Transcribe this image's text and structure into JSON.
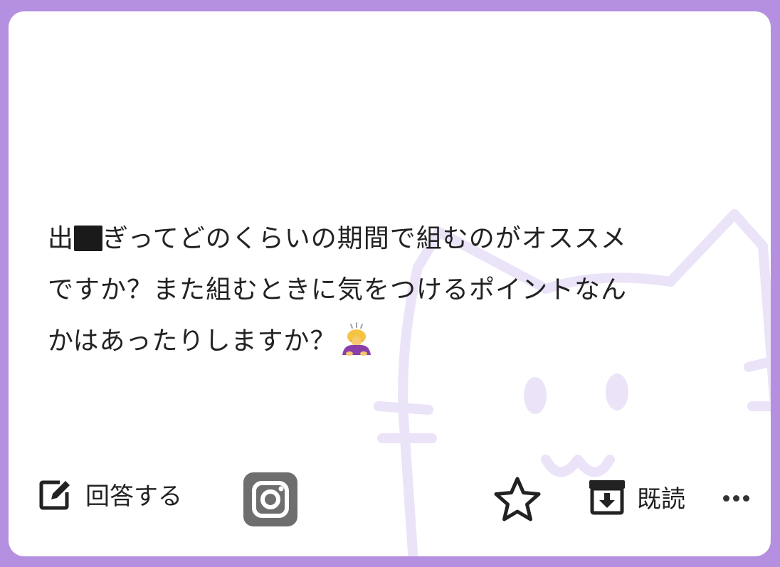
{
  "question": {
    "line1_prefix": "出",
    "line1_rest": "ぎってどのくらいの期間で組むのがオススメ",
    "line2": "ですか？また組むときに気をつけるポイントなん",
    "line3": "かはあったりしますか？"
  },
  "actions": {
    "answer_label": "回答する",
    "read_label": "既読"
  },
  "icons": [
    "edit-icon",
    "instagram-icon",
    "star-icon",
    "archive-icon",
    "more-icon",
    "bowing-person-emoji",
    "cat-watermark"
  ],
  "colors": {
    "frame": "#b58fe0",
    "card": "#ffffff",
    "text": "#222222",
    "watermark": "#e9e0f7",
    "instagram_icon": "#6e6e6e"
  }
}
